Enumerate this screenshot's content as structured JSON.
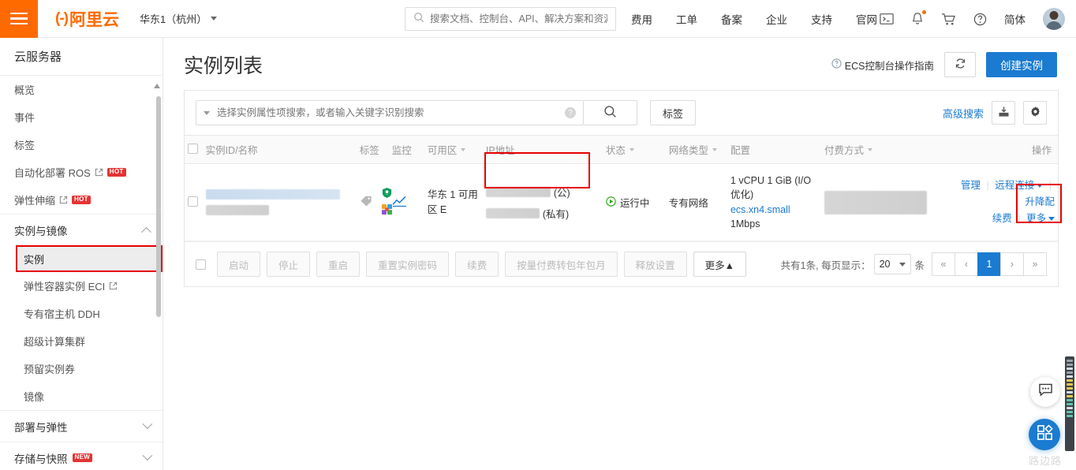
{
  "header": {
    "logo_mark": "(-)",
    "logo_text": "阿里云",
    "region": "华东1（杭州）",
    "search_placeholder": "搜索文档、控制台、API、解决方案和资源",
    "nav": [
      {
        "label": "费用"
      },
      {
        "label": "工单"
      },
      {
        "label": "备案"
      },
      {
        "label": "企业"
      },
      {
        "label": "支持"
      },
      {
        "label": "官网"
      }
    ],
    "lang": "简体"
  },
  "sidebar": {
    "title": "云服务器",
    "items": [
      {
        "label": "概览",
        "sub": false
      },
      {
        "label": "事件",
        "sub": false
      },
      {
        "label": "标签",
        "sub": false
      },
      {
        "label": "自动化部署 ROS",
        "sub": false,
        "external": true,
        "badge": "HOT"
      },
      {
        "label": "弹性伸缩",
        "sub": false,
        "external": true,
        "badge": "HOT"
      }
    ],
    "group_instances": "实例与镜像",
    "sub_items": [
      {
        "label": "实例",
        "active": true
      },
      {
        "label": "弹性容器实例 ECI",
        "external": true
      },
      {
        "label": "专有宿主机 DDH"
      },
      {
        "label": "超级计算集群"
      },
      {
        "label": "预留实例券"
      },
      {
        "label": "镜像"
      }
    ],
    "group_deploy": "部署与弹性",
    "group_storage": "存储与快照",
    "group_storage_badge": "NEW"
  },
  "page": {
    "title": "实例列表",
    "guide_link": "ECS控制台操作指南",
    "create_button": "创建实例"
  },
  "filter": {
    "search_placeholder": "选择实例属性项搜索，或者输入关键字识别搜索",
    "tag_button": "标签",
    "advanced_search": "高级搜索"
  },
  "table": {
    "columns": [
      {
        "label": "实例ID/名称",
        "sortable": false
      },
      {
        "label": "标签",
        "sortable": false
      },
      {
        "label": "监控",
        "sortable": false
      },
      {
        "label": "可用区",
        "sortable": true
      },
      {
        "label": "IP地址",
        "sortable": false
      },
      {
        "label": "状态",
        "sortable": true
      },
      {
        "label": "网络类型",
        "sortable": true
      },
      {
        "label": "配置",
        "sortable": false
      },
      {
        "label": "付费方式",
        "sortable": true
      },
      {
        "label": "操作",
        "sortable": false
      }
    ],
    "rows": [
      {
        "zone": "华东 1 可用区 E",
        "ip_public_suffix": "(公)",
        "ip_private_suffix": "(私有)",
        "status": "运行中",
        "network_type": "专有网络",
        "config_spec": "1 vCPU 1 GiB (I/O优化)",
        "config_type": "ecs.xn4.small",
        "config_bandwidth": "1Mbps",
        "actions": {
          "manage": "管理",
          "remote": "远程连接",
          "resize": "升降配",
          "renew": "续费",
          "more": "更多"
        }
      }
    ]
  },
  "footer": {
    "buttons": [
      {
        "label": "启动",
        "enabled": false
      },
      {
        "label": "停止",
        "enabled": false
      },
      {
        "label": "重启",
        "enabled": false
      },
      {
        "label": "重置实例密码",
        "enabled": false
      },
      {
        "label": "续费",
        "enabled": false
      },
      {
        "label": "按量付费转包年包月",
        "enabled": false
      },
      {
        "label": "释放设置",
        "enabled": false
      },
      {
        "label": "更多▲",
        "enabled": true
      }
    ],
    "total_text": "共有1条, 每页显示：",
    "page_size": "20",
    "unit": "条",
    "pages": [
      {
        "label": "«",
        "active": false
      },
      {
        "label": "‹",
        "active": false
      },
      {
        "label": "1",
        "active": true
      },
      {
        "label": "›",
        "active": false
      },
      {
        "label": "»",
        "active": false
      }
    ]
  },
  "watermark": "路边路",
  "colors": {
    "brand_orange": "#ff6a00",
    "link_blue": "#1b7bd0",
    "annotation_red": "#e60000",
    "status_green": "#2aa515"
  }
}
